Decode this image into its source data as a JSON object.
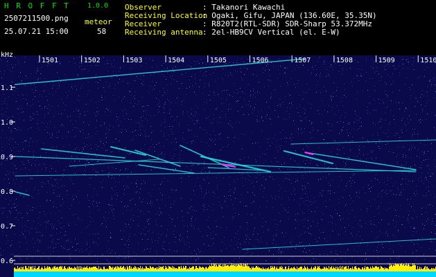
{
  "header": {
    "app_title": "H R O F F T",
    "version": "1.0.0",
    "filename": "2507211500.png",
    "meteor_label": "meteor",
    "datetime": "25.07.21 15:00",
    "meteor_count": "58",
    "info_labels": [
      "Observer",
      "Receiving Location",
      "Receiver",
      "Receiving antenna"
    ],
    "info_values": [
      ": Takanori Kawachi",
      ": Ogaki, Gifu, JAPAN (136.60E, 35.35N)",
      ": R820T2(RTL-SDR) SDR-Sharp 53.372MHz",
      ": 2el-HB9CV Vertical (el. E-W)"
    ]
  },
  "spectrogram": {
    "unit_label": "kHz",
    "time_labels": [
      "1501",
      "1502",
      "1503",
      "1504",
      "1505",
      "1506",
      "1507",
      "1508",
      "1509",
      "1510"
    ],
    "freq_labels": [
      "1.1",
      "1.0",
      "0.9",
      "0.8",
      "0.7",
      "0.6"
    ],
    "colors": {
      "background": "#0a0a4a",
      "noise": "#2a3aa0",
      "trace": "#28e0e0",
      "hot": "#ff30ff",
      "bar": "#ffee00",
      "bar_base": "#00d8ff"
    }
  }
}
